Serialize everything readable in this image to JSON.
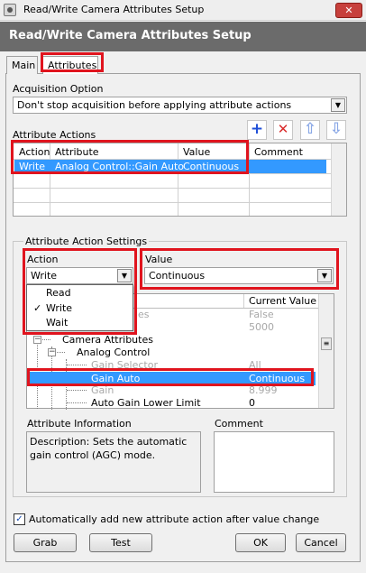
{
  "window": {
    "title": "Read/Write Camera Attributes Setup",
    "close_glyph": "✕"
  },
  "header": {
    "title": "Read/Write Camera Attributes Setup"
  },
  "tabs": [
    {
      "label": "Main"
    },
    {
      "label": "Attributes"
    }
  ],
  "acquisition": {
    "label": "Acquisition Option",
    "value": "Don't stop acquisition before applying attribute actions"
  },
  "attribute_actions": {
    "label": "Attribute Actions",
    "toolbar": {
      "add": "+",
      "delete": "✕",
      "up": "⇧",
      "down": "⇩"
    },
    "columns": [
      "Action",
      "Attribute",
      "Value",
      "Comment"
    ],
    "rows": [
      {
        "action": "Write",
        "attribute": "Analog Control::Gain Auto",
        "value": "Continuous",
        "comment": ""
      }
    ]
  },
  "settings": {
    "label": "Attribute Action Settings",
    "action": {
      "label": "Action",
      "value": "Write",
      "options": [
        {
          "label": "Read",
          "checked": false
        },
        {
          "label": "Write",
          "checked": true
        },
        {
          "label": "Wait",
          "checked": false
        }
      ]
    },
    "value": {
      "label": "Value",
      "value": "Continuous"
    },
    "tree": {
      "current_value_header": "Current Value",
      "rows": [
        {
          "label": "es",
          "value": "False",
          "disabled": true
        },
        {
          "label": "",
          "value": "5000",
          "disabled": true
        },
        {
          "label": "Camera Attributes",
          "value": "",
          "disabled": false
        },
        {
          "label": "Analog Control",
          "value": "",
          "disabled": false
        },
        {
          "label": "Gain Selector",
          "value": "All",
          "disabled": true
        },
        {
          "label": "Gain Auto",
          "value": "Continuous",
          "disabled": false,
          "selected": true
        },
        {
          "label": "Gain",
          "value": "8.999",
          "disabled": true
        },
        {
          "label": "Auto Gain Lower Limit",
          "value": "0",
          "disabled": false
        }
      ]
    },
    "info": {
      "label": "Attribute Information",
      "description": "Description: Sets the automatic gain control (AGC) mode."
    },
    "comment": {
      "label": "Comment",
      "value": ""
    }
  },
  "auto_add": {
    "label": "Automatically add new attribute action after value change",
    "checked": true
  },
  "buttons": {
    "grab": "Grab",
    "test": "Test",
    "ok": "OK",
    "cancel": "Cancel"
  },
  "colors": {
    "selection": "#3399ff",
    "highlight_red": "#e0141e",
    "header_gray": "#6b6b6b",
    "add_blue": "#1f4fd8",
    "delete_red": "#d92b2b",
    "arrow_blue": "#8aa8e6"
  }
}
